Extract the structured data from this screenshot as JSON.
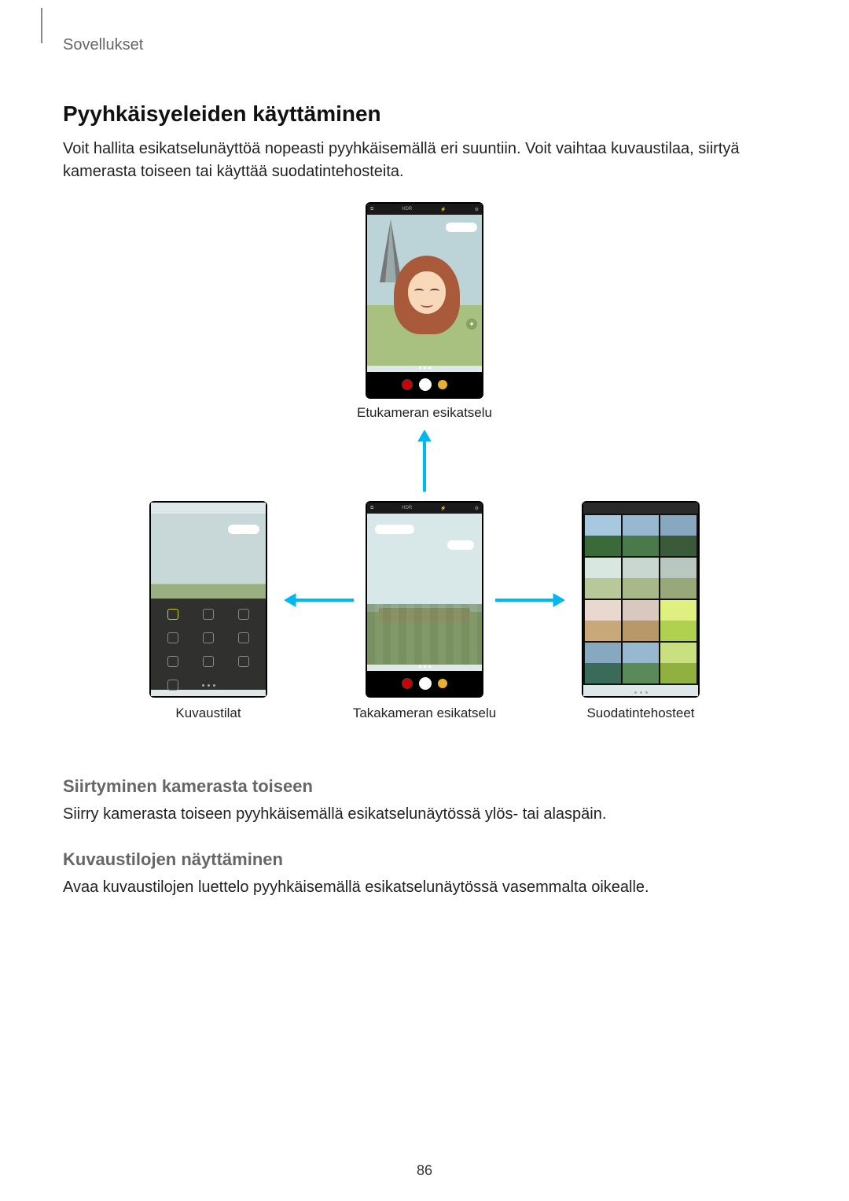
{
  "header": {
    "section": "Sovellukset"
  },
  "title": "Pyyhkäisyeleiden käyttäminen",
  "intro": "Voit hallita esikatselunäyttöä nopeasti pyyhkäisemällä eri suuntiin. Voit vaihtaa kuvaustilaa, siirtyä kamerasta toiseen tai käyttää suodatintehosteita.",
  "captions": {
    "front": "Etukameran esikatselu",
    "modes": "Kuvaustilat",
    "rear": "Takakameran esikatselu",
    "filters": "Suodatintehosteet"
  },
  "topbar_label": "HDR",
  "sections": {
    "switch_title": "Siirtyminen kamerasta toiseen",
    "switch_body": "Siirry kamerasta toiseen pyyhkäisemällä esikatselunäytössä ylös- tai alaspäin.",
    "modes_title": "Kuvaustilojen näyttäminen",
    "modes_body": "Avaa kuvaustilojen luettelo pyyhkäisemällä esikatselunäytössä vasemmalta oikealle."
  },
  "page_number": "86"
}
